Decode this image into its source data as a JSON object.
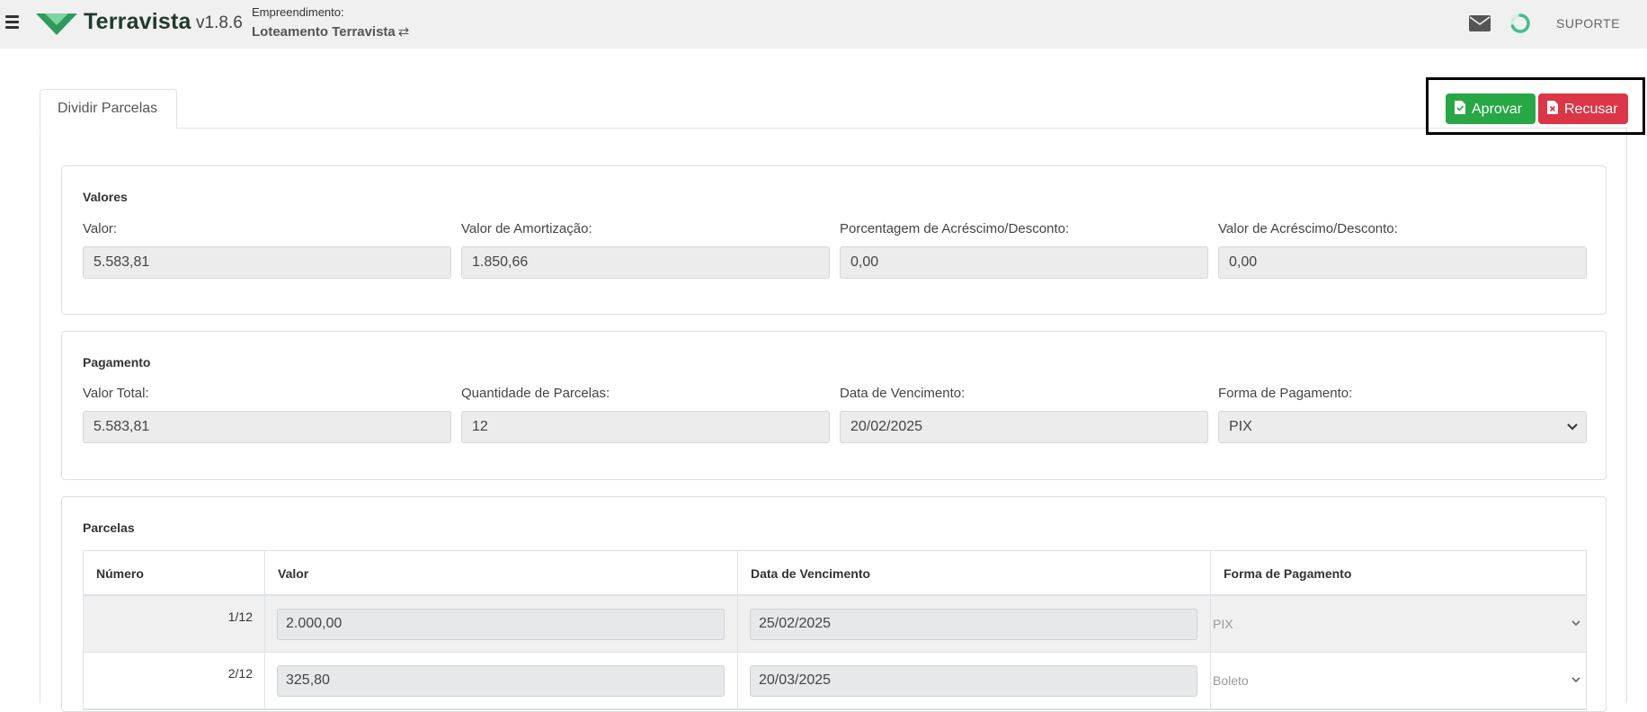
{
  "header": {
    "brand": "Terravista",
    "version": "v1.8.6",
    "empreendimento_label": "Empreendimento:",
    "empreendimento_name": "Loteamento Terravista",
    "swap_symbol": "⇄",
    "support": "SUPORTE",
    "icons": [
      "menu-icon",
      "logo-icon",
      "swap-icon",
      "mail-icon",
      "spinner-icon"
    ],
    "colors": {
      "logo": "#2e9b5a",
      "spinner": "#3fbf8f",
      "bar_bg": "#f0f0f0"
    }
  },
  "tab": {
    "label": "Dividir Parcelas"
  },
  "actions": {
    "approve": "Aprovar",
    "refuse": "Recusar",
    "colors": {
      "approve": "#28a745",
      "refuse": "#dc3545"
    }
  },
  "valores": {
    "title": "Valores",
    "fields": [
      {
        "label": "Valor:",
        "value": "5.583,81"
      },
      {
        "label": "Valor de Amortização:",
        "value": "1.850,66"
      },
      {
        "label": "Porcentagem de Acréscimo/Desconto:",
        "value": "0,00"
      },
      {
        "label": "Valor de Acréscimo/Desconto:",
        "value": "0,00"
      }
    ]
  },
  "pagamento": {
    "title": "Pagamento",
    "fields": [
      {
        "label": "Valor Total:",
        "value": "5.583,81"
      },
      {
        "label": "Quantidade de Parcelas:",
        "value": "12"
      },
      {
        "label": "Data de Vencimento:",
        "value": "20/02/2025"
      },
      {
        "label": "Forma de Pagamento:",
        "value": "PIX"
      }
    ]
  },
  "parcelas": {
    "title": "Parcelas",
    "columns": [
      "Número",
      "Valor",
      "Data de Vencimento",
      "Forma de Pagamento"
    ],
    "rows": [
      {
        "numero": "1/12",
        "valor": "2.000,00",
        "vencimento": "25/02/2025",
        "forma": "PIX"
      },
      {
        "numero": "2/12",
        "valor": "325,80",
        "vencimento": "20/03/2025",
        "forma": "Boleto"
      }
    ]
  }
}
